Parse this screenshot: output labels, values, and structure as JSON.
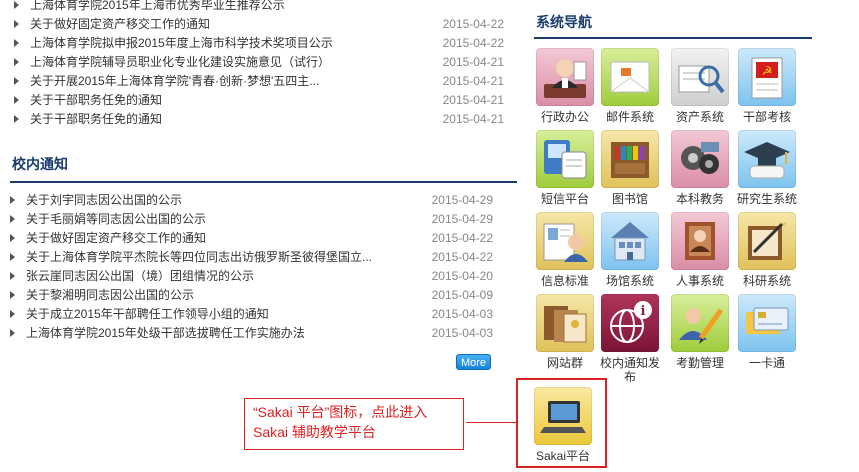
{
  "top_news": [
    {
      "title": "上海体育学院2015年上海市优秀毕业生推荐公示",
      "date": ""
    },
    {
      "title": "关于做好固定资产移交工作的通知",
      "date": "2015-04-22"
    },
    {
      "title": "上海体育学院拟申报2015年度上海市科学技术奖项目公示",
      "date": "2015-04-22"
    },
    {
      "title": "上海体育学院辅导员职业化专业化建设实施意见（试行）",
      "date": "2015-04-21"
    },
    {
      "title": "关于开展2015年上海体育学院'青春·创新·梦想'五四主...",
      "date": "2015-04-21"
    },
    {
      "title": "关于干部职务任免的通知",
      "date": "2015-04-21"
    },
    {
      "title": "关于干部职务任免的通知",
      "date": "2015-04-21"
    }
  ],
  "notice": {
    "title": "校内通知",
    "items": [
      {
        "title": "关于刘宇同志因公出国的公示",
        "date": "2015-04-29"
      },
      {
        "title": "关于毛丽娟等同志因公出国的公示",
        "date": "2015-04-29"
      },
      {
        "title": "关于做好固定资产移交工作的通知",
        "date": "2015-04-22"
      },
      {
        "title": "关于上海体育学院平杰院长等四位同志出访俄罗斯圣彼得堡国立...",
        "date": "2015-04-22"
      },
      {
        "title": "张云崖同志因公出国（境）团组情况的公示",
        "date": "2015-04-20"
      },
      {
        "title": "关于黎湘明同志因公出国的公示",
        "date": "2015-04-09"
      },
      {
        "title": "关于成立2015年干部聘任工作领导小组的通知",
        "date": "2015-04-03"
      },
      {
        "title": "上海体育学院2015年处级干部选拔聘任工作实施办法",
        "date": "2015-04-03"
      }
    ],
    "more_label": "More"
  },
  "nav": {
    "title": "系统导航",
    "tiles": [
      {
        "label": "行政办公",
        "icon": "office-icon"
      },
      {
        "label": "邮件系统",
        "icon": "mail-icon"
      },
      {
        "label": "资产系统",
        "icon": "asset-icon"
      },
      {
        "label": "干部考核",
        "icon": "cadre-icon"
      },
      {
        "label": "短信平台",
        "icon": "sms-icon"
      },
      {
        "label": "图书馆",
        "icon": "library-icon"
      },
      {
        "label": "本科教务",
        "icon": "academic-icon"
      },
      {
        "label": "研究生系统",
        "icon": "graduate-icon"
      },
      {
        "label": "信息标准",
        "icon": "info-standard-icon"
      },
      {
        "label": "场馆系统",
        "icon": "venue-icon"
      },
      {
        "label": "人事系统",
        "icon": "personnel-icon"
      },
      {
        "label": "科研系统",
        "icon": "research-icon"
      },
      {
        "label": "网站群",
        "icon": "websites-icon"
      },
      {
        "label": "校内通知发布",
        "icon": "notice-publish-icon"
      },
      {
        "label": "考勤管理",
        "icon": "attendance-icon"
      },
      {
        "label": "一卡通",
        "icon": "card-icon"
      }
    ],
    "sakai": {
      "label": "Sakai平台",
      "icon": "sakai-laptop-icon"
    }
  },
  "annotation": {
    "text": "“Sakai 平台”图标，点此进入 Sakai 辅助教学平台",
    "color": "#dd2222"
  }
}
